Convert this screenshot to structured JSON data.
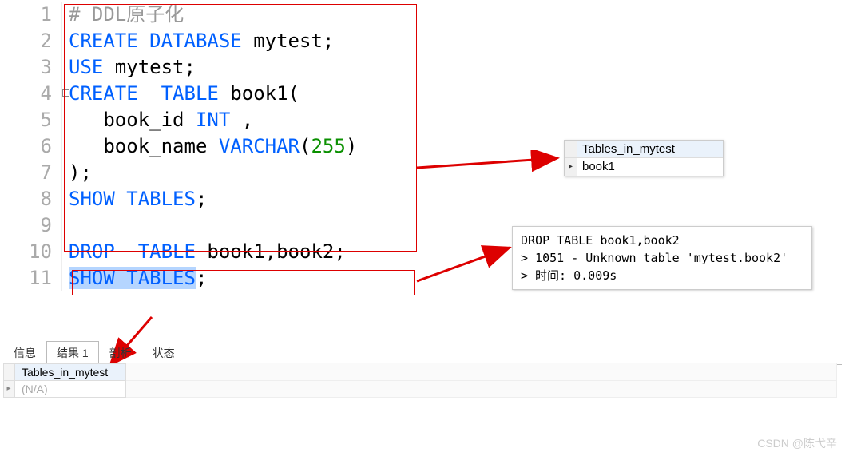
{
  "code": {
    "lines": [
      {
        "n": "1",
        "segs": [
          {
            "t": "# ",
            "c": "comment"
          },
          {
            "t": "DDL原子化",
            "c": "comment"
          }
        ]
      },
      {
        "n": "2",
        "segs": [
          {
            "t": "CREATE",
            "c": "kw"
          },
          {
            "t": " "
          },
          {
            "t": "DATABASE",
            "c": "kw"
          },
          {
            "t": " mytest;"
          }
        ]
      },
      {
        "n": "3",
        "segs": [
          {
            "t": "USE",
            "c": "kw"
          },
          {
            "t": " mytest;"
          }
        ]
      },
      {
        "n": "4",
        "segs": [
          {
            "t": "CREATE",
            "c": "kw"
          },
          {
            "t": "  "
          },
          {
            "t": "TABLE",
            "c": "kw"
          },
          {
            "t": " book1("
          }
        ]
      },
      {
        "n": "5",
        "segs": [
          {
            "t": "   book_id "
          },
          {
            "t": "INT",
            "c": "type"
          },
          {
            "t": " ,"
          }
        ]
      },
      {
        "n": "6",
        "segs": [
          {
            "t": "   book_name "
          },
          {
            "t": "VARCHAR",
            "c": "type"
          },
          {
            "t": "("
          },
          {
            "t": "255",
            "c": "num"
          },
          {
            "t": ")"
          }
        ]
      },
      {
        "n": "7",
        "segs": [
          {
            "t": ");"
          }
        ]
      },
      {
        "n": "8",
        "segs": [
          {
            "t": "SHOW",
            "c": "kw"
          },
          {
            "t": " "
          },
          {
            "t": "TABLES",
            "c": "kw"
          },
          {
            "t": ";"
          }
        ]
      },
      {
        "n": "9",
        "segs": [
          {
            "t": ""
          }
        ]
      },
      {
        "n": "10",
        "segs": [
          {
            "t": "DROP",
            "c": "kw"
          },
          {
            "t": "  "
          },
          {
            "t": "TABLE",
            "c": "kw"
          },
          {
            "t": " book1,book2;"
          }
        ]
      },
      {
        "n": "11",
        "segs": [
          {
            "t": "SHOW",
            "c": "kw sel"
          },
          {
            "t": " ",
            "c": "sel"
          },
          {
            "t": "TABLES",
            "c": "kw sel"
          },
          {
            "t": ";"
          }
        ]
      }
    ]
  },
  "popup1": {
    "header": "Tables_in_mytest",
    "value": "book1"
  },
  "popup2": {
    "l1": "DROP TABLE book1,book2",
    "l2": "> 1051 - Unknown table 'mytest.book2'",
    "l3": "> 时间: 0.009s"
  },
  "tabs": {
    "t1": "信息",
    "t2": "结果 1",
    "t3": "剖析",
    "t4": "状态"
  },
  "resultTable": {
    "header": "Tables_in_mytest",
    "row1": "(N/A)"
  },
  "watermark": "CSDN @陈弋辛"
}
